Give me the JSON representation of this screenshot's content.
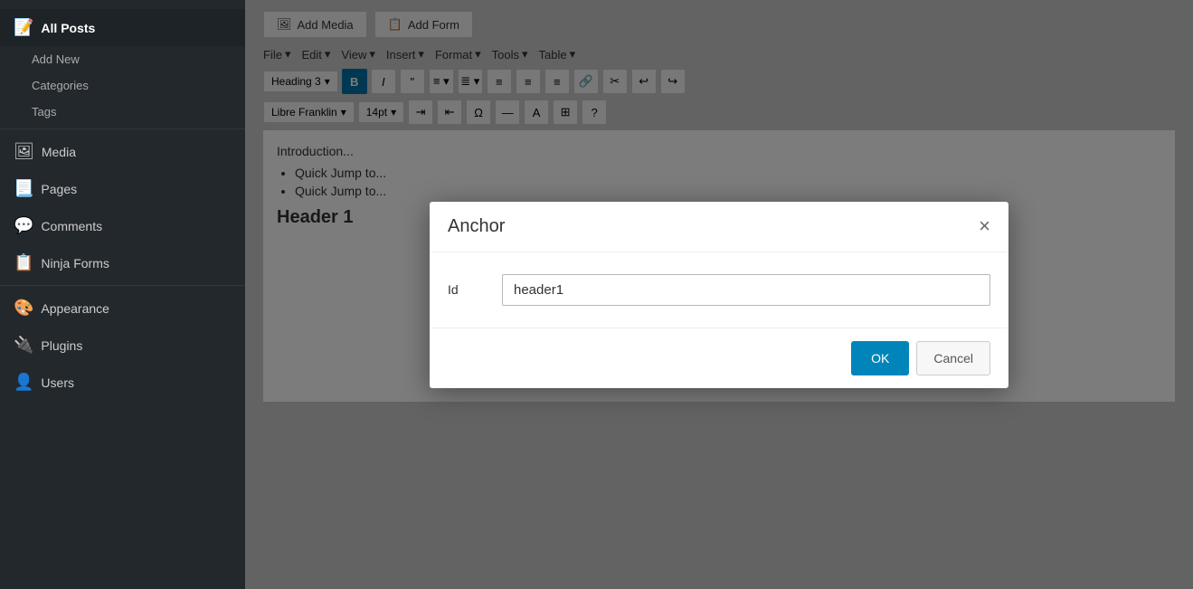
{
  "sidebar": {
    "items": [
      {
        "id": "all-posts",
        "label": "All Posts",
        "icon": "📄",
        "active": true,
        "sub": []
      },
      {
        "id": "add-new",
        "label": "Add New",
        "icon": "",
        "sub_only": true
      },
      {
        "id": "categories",
        "label": "Categories",
        "icon": "",
        "sub_only": true
      },
      {
        "id": "tags",
        "label": "Tags",
        "icon": "",
        "sub_only": true
      },
      {
        "id": "media",
        "label": "Media",
        "icon": "🖼",
        "active": false
      },
      {
        "id": "pages",
        "label": "Pages",
        "icon": "📃",
        "active": false
      },
      {
        "id": "comments",
        "label": "Comments",
        "icon": "💬",
        "active": false
      },
      {
        "id": "ninja-forms",
        "label": "Ninja Forms",
        "icon": "📋",
        "active": false
      },
      {
        "id": "appearance",
        "label": "Appearance",
        "icon": "🎨",
        "active": false
      },
      {
        "id": "plugins",
        "label": "Plugins",
        "icon": "🔌",
        "active": false
      },
      {
        "id": "users",
        "label": "Users",
        "icon": "👤",
        "active": false
      }
    ]
  },
  "toolbar": {
    "btn_add_media": "Add Media",
    "btn_add_form": "Add Form",
    "menus": [
      "File",
      "Edit",
      "View",
      "Insert",
      "Format",
      "Tools",
      "Table"
    ],
    "format_select": "Heading 3",
    "font_select": "Libre Franklin",
    "size_select": "14pt"
  },
  "editor": {
    "content_intro": "Introduction...",
    "list_items": [
      "Quick Jump to...",
      "Quick Jump to..."
    ],
    "heading": "Header 1"
  },
  "modal": {
    "title": "Anchor",
    "close_label": "×",
    "id_label": "Id",
    "id_value": "header1",
    "ok_label": "OK",
    "cancel_label": "Cancel"
  }
}
